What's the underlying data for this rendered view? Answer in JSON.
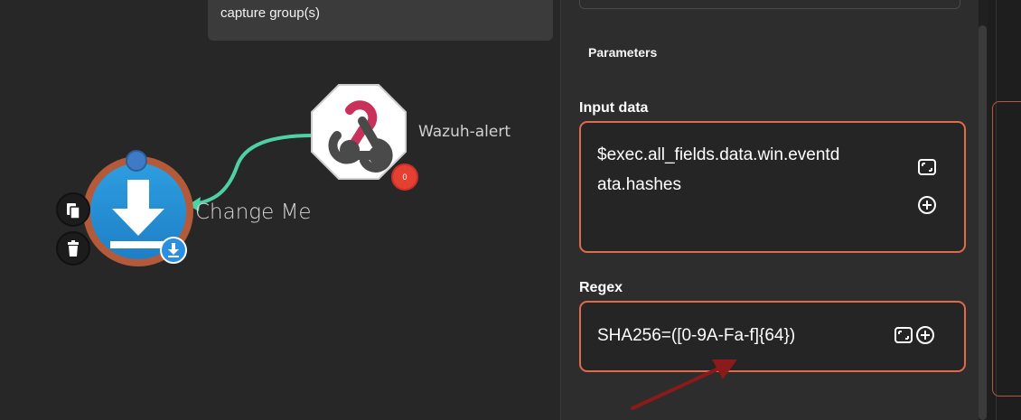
{
  "canvas": {
    "tooltip_text": "capture group(s)",
    "webhook_node": {
      "label": "Wazuh-alert",
      "badge_count": "0",
      "icon": "webhook-icon"
    },
    "action_node": {
      "label": "Change Me",
      "icon": "download-icon"
    },
    "side_buttons": [
      {
        "icon": "copy-icon"
      },
      {
        "icon": "trash-icon"
      }
    ],
    "colors": {
      "edge": "#4fd1a6",
      "node_ring": "#e06a4a",
      "badge": "#e64032"
    }
  },
  "panel": {
    "section_title": "Parameters",
    "fields": [
      {
        "label": "Input data",
        "value_line1": "$exec.all_fields.data.win.eventd",
        "value_line2": "ata.hashes"
      },
      {
        "label": "Regex",
        "value": "SHA256=([0-9A-Fa-f]{64})"
      }
    ],
    "colors": {
      "field_border": "#e06a4a"
    }
  }
}
